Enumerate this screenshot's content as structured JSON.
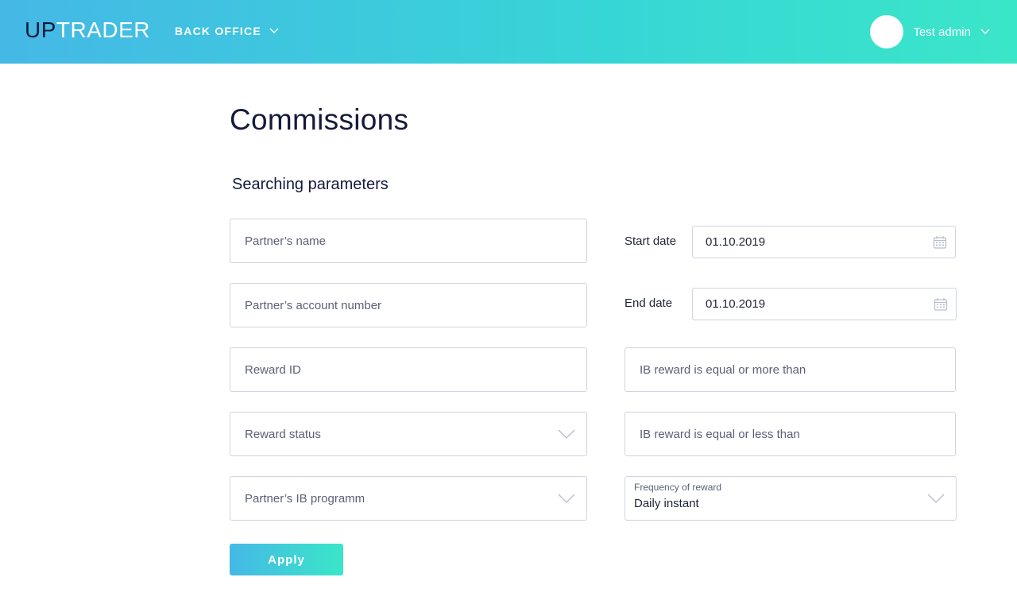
{
  "header": {
    "logo_up": "UP",
    "logo_trader": "TRADER",
    "nav_label": "BACK OFFICE",
    "user_name": "Test admin"
  },
  "page": {
    "title": "Commissions",
    "section_title": "Searching parameters"
  },
  "form": {
    "partner_name_placeholder": "Partner’s name",
    "partner_account_placeholder": "Partner’s account number",
    "reward_id_placeholder": "Reward ID",
    "reward_status_label": "Reward status",
    "ib_programm_label": "Partner’s IB programm",
    "start_date_label": "Start date",
    "start_date_value": "01.10.2019",
    "end_date_label": "End date",
    "end_date_value": "01.10.2019",
    "ib_reward_more_placeholder": "IB reward is equal or more than",
    "ib_reward_less_placeholder": "IB reward is equal or less than",
    "frequency_caption": "Frequency of reward",
    "frequency_value": "Daily instant",
    "apply_label": "Apply"
  },
  "colors": {
    "header_gradient_start": "#45b8e6",
    "header_gradient_end": "#3ae6c8",
    "title_text": "#141a3b",
    "field_border": "#cfd4e0"
  },
  "icons": {
    "nav_chevron": "chevron-down-icon",
    "user_chevron": "chevron-down-icon",
    "date_picker": "calendar-icon",
    "select_chevron": "chevron-down-icon"
  }
}
